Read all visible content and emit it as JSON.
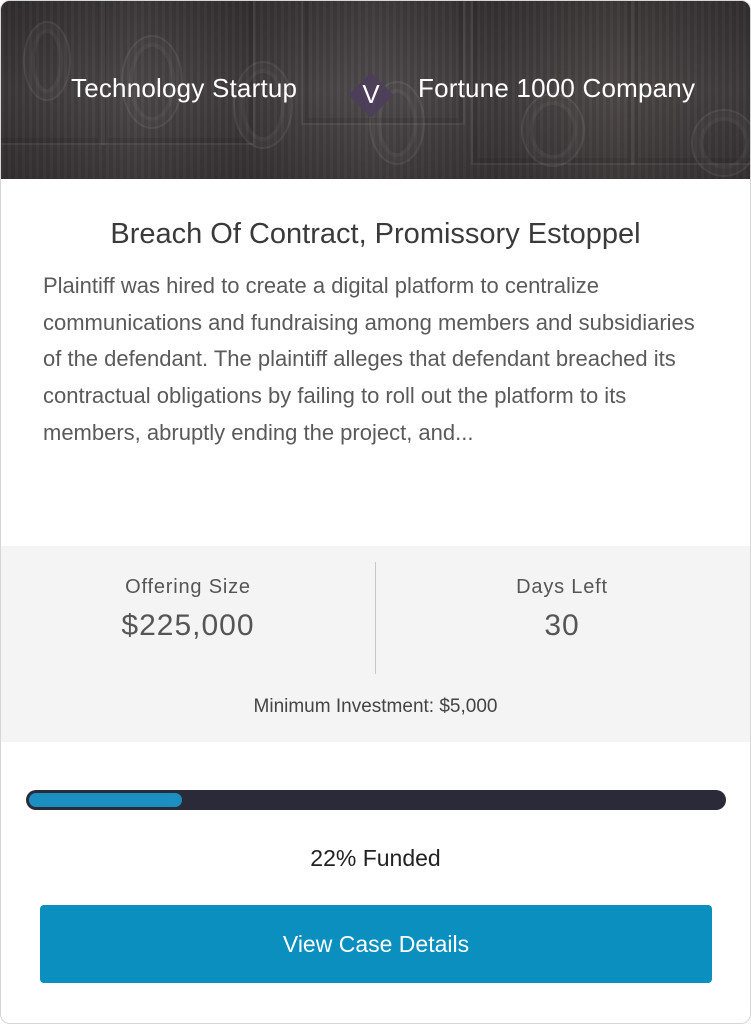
{
  "header": {
    "plaintiff": "Technology Startup",
    "vs_label": "V",
    "defendant": "Fortune 1000 Company"
  },
  "case": {
    "title": "Breach Of Contract, Promissory Estoppel",
    "description": "Plaintiff was hired to create a digital platform to centralize communications and fundraising among members and subsidiaries of the defendant. The plaintiff alleges that defendant breached its contractual obligations by failing to roll out the platform to its members, abruptly ending the project, and..."
  },
  "stats": {
    "offering_size_label": "Offering Size",
    "offering_size_value": "$225,000",
    "days_left_label": "Days Left",
    "days_left_value": "30",
    "minimum_investment": "Minimum Investment: $5,000"
  },
  "progress": {
    "funded_percent": 22,
    "funded_text": "22% Funded"
  },
  "cta": {
    "label": "View Case Details"
  },
  "colors": {
    "accent": "#0b8fbf",
    "progress_fill": "#1b8fc2",
    "progress_track": "#2a2a38",
    "vs_badge": "#4d3e5a"
  }
}
